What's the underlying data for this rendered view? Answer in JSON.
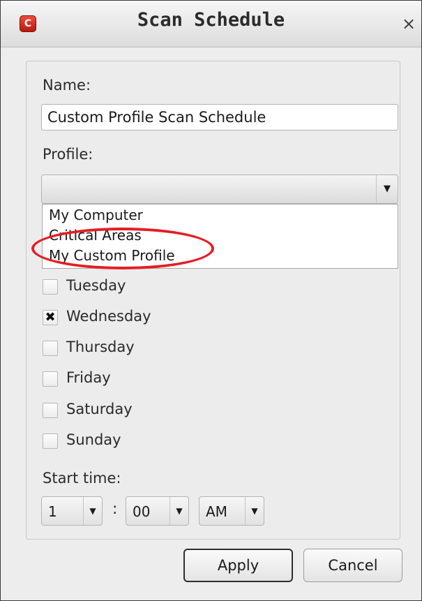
{
  "window": {
    "title": "Scan Schedule",
    "app_icon_letter": "C",
    "close_glyph": "×"
  },
  "form": {
    "name_label": "Name:",
    "name_value": "Custom Profile Scan Schedule",
    "profile_label": "Profile:",
    "profile_selected": "",
    "profile_options": [
      "My Computer",
      "Critical Areas",
      "My Custom Profile"
    ],
    "highlighted_option": "My Custom Profile",
    "days": [
      {
        "label": "Tuesday",
        "checked": false
      },
      {
        "label": "Wednesday",
        "checked": true
      },
      {
        "label": "Thursday",
        "checked": false
      },
      {
        "label": "Friday",
        "checked": false
      },
      {
        "label": "Saturday",
        "checked": false
      },
      {
        "label": "Sunday",
        "checked": false
      }
    ],
    "start_time_label": "Start time:",
    "hour": "1",
    "time_separator": ":",
    "minute": "00",
    "ampm": "AM"
  },
  "buttons": {
    "apply": "Apply",
    "cancel": "Cancel"
  },
  "colors": {
    "highlight": "#e41e25",
    "brand": "#d6281a"
  },
  "icons": {
    "checkmark": "✖",
    "dropdown_arrow": "▼"
  }
}
